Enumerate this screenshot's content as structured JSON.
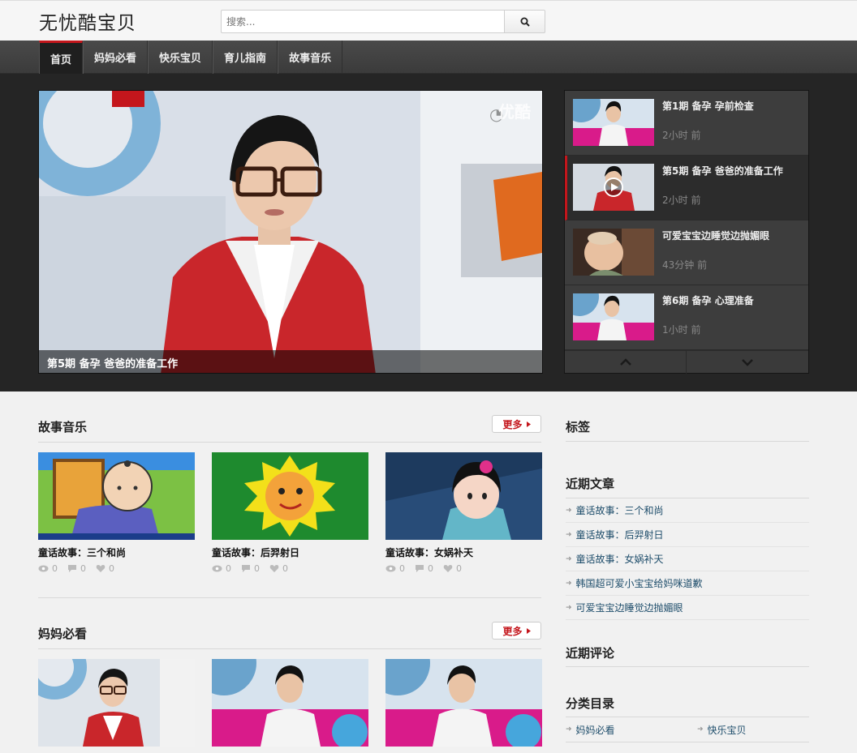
{
  "site": {
    "logo": "无忧酷宝贝"
  },
  "search": {
    "placeholder": "搜索..."
  },
  "nav": {
    "items": [
      "首页",
      "妈妈必看",
      "快乐宝贝",
      "育儿指南",
      "故事音乐"
    ],
    "active": 0
  },
  "hero": {
    "caption": "第5期 备孕 爸爸的准备工作",
    "brand": "优酷",
    "playlist": [
      {
        "title": "第1期 备孕 孕前检查",
        "time": "2小时 前"
      },
      {
        "title": "第5期 备孕 爸爸的准备工作",
        "time": "2小时 前",
        "active": true
      },
      {
        "title": "可爱宝宝边睡觉边抛媚眼",
        "time": "43分钟 前"
      },
      {
        "title": "第6期 备孕 心理准备",
        "time": "1小时 前"
      }
    ]
  },
  "sections": [
    {
      "title": "故事音乐",
      "more": "更多",
      "cards": [
        {
          "title": "童话故事：三个和尚",
          "views": "0",
          "comments": "0",
          "likes": "0"
        },
        {
          "title": "童话故事：后羿射日",
          "views": "0",
          "comments": "0",
          "likes": "0"
        },
        {
          "title": "童话故事：女娲补天",
          "views": "0",
          "comments": "0",
          "likes": "0"
        }
      ]
    },
    {
      "title": "妈妈必看",
      "more": "更多",
      "cards": [
        {
          "title": ""
        },
        {
          "title": ""
        },
        {
          "title": ""
        }
      ]
    }
  ],
  "sidebar": {
    "tags_title": "标签",
    "recent_posts_title": "近期文章",
    "recent_posts": [
      "童话故事：三个和尚",
      "童话故事：后羿射日",
      "童话故事：女娲补天",
      "韩国超可爱小宝宝给妈咪道歉",
      "可爱宝宝边睡觉边抛媚眼"
    ],
    "recent_comments_title": "近期评论",
    "categories_title": "分类目录",
    "categories": [
      "妈妈必看",
      "快乐宝贝"
    ]
  },
  "colors": {
    "accent": "#c4161c",
    "link": "#1e4d6b",
    "nav_bg": "#3b3b3b",
    "hero_bg": "#252525"
  }
}
